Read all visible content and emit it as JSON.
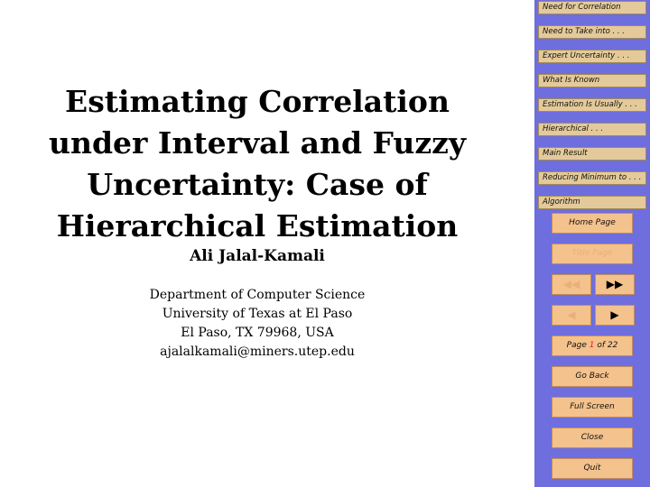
{
  "slide": {
    "title_lines": [
      "Estimating Correlation",
      "under Interval and Fuzzy",
      "Uncertainty: Case of",
      "Hierarchical Estimation"
    ],
    "author": "Ali Jalal-Kamali",
    "affiliation_lines": [
      "Department of Computer Science",
      "University of Texas at El Paso",
      "El Paso, TX 79968, USA",
      "ajalalkamali@miners.utep.edu"
    ]
  },
  "nav": {
    "sections": [
      "Need for Correlation",
      "Need to Take into . . .",
      "Expert Uncertainty . . .",
      "What Is Known",
      "Estimation Is Usually . . .",
      "Hierarchical . . .",
      "Main Result",
      "Reducing Minimum to . . .",
      "Algorithm"
    ],
    "home_page": "Home Page",
    "title_page": "Title Page",
    "first_symbol": "◀◀",
    "last_symbol": "▶▶",
    "prev_symbol": "◀",
    "next_symbol": "▶",
    "page_prefix": "Page ",
    "page_current": "1",
    "page_of": " of ",
    "page_total": "22",
    "go_back": "Go Back",
    "full_screen": "Full Screen",
    "close": "Close",
    "quit": "Quit"
  },
  "colors": {
    "panel": "#6e6ede",
    "section_link": "#e4ca9a",
    "button": "#f4c28c",
    "page_current": "#e02020"
  }
}
